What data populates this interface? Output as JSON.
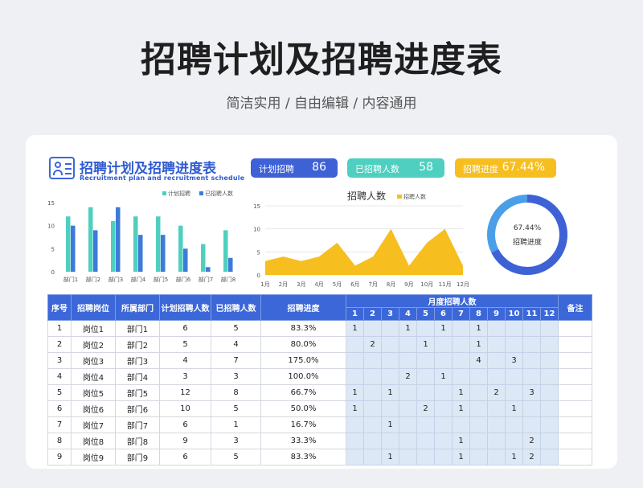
{
  "page": {
    "title": "招聘计划及招聘进度表",
    "subtitle": "简洁实用 / 自由编辑 / 内容通用"
  },
  "card": {
    "title": "招聘计划及招聘进度表",
    "title_en": "Recruitment plan and recruitment schedule",
    "kpis": [
      {
        "label": "计划招聘",
        "value": "86",
        "color": "#3e62d6"
      },
      {
        "label": "已招聘人数",
        "value": "58",
        "color": "#4fcfbf"
      },
      {
        "label": "招聘进度",
        "value": "67.44%",
        "color": "#f6be1f"
      }
    ]
  },
  "chart_data": [
    {
      "type": "bar",
      "categories": [
        "部门1",
        "部门2",
        "部门3",
        "部门4",
        "部门5",
        "部门6",
        "部门7",
        "部门8"
      ],
      "series": [
        {
          "name": "计划招聘",
          "values": [
            12,
            14,
            11,
            12,
            12,
            10,
            6,
            9
          ],
          "color": "#4fcfbf"
        },
        {
          "name": "已招聘人数",
          "values": [
            10,
            9,
            14,
            8,
            8,
            5,
            1,
            3
          ],
          "color": "#3e7ad8"
        }
      ],
      "ylim": [
        0,
        15
      ],
      "yticks": [
        "15",
        "10",
        "5",
        "0"
      ],
      "legend": "top-right"
    },
    {
      "type": "area",
      "title": "招聘人数",
      "categories": [
        "1月",
        "2月",
        "3月",
        "4月",
        "5月",
        "6月",
        "7月",
        "8月",
        "9月",
        "10月",
        "11月",
        "12月"
      ],
      "series": [
        {
          "name": "招聘人数",
          "values": [
            3,
            4,
            3,
            4,
            7,
            2,
            4,
            10,
            2,
            7,
            10,
            2
          ],
          "color": "#f6be1f"
        }
      ],
      "ylim": [
        0,
        15
      ],
      "yticks": [
        "15",
        "10",
        "5",
        "0"
      ],
      "grid": true,
      "legend": "top"
    },
    {
      "type": "pie",
      "title": "招聘进度",
      "value_label": "67.44%",
      "value": 67.44,
      "colors": {
        "done": "#3e62d6",
        "rest": "#4a9fe8"
      }
    }
  ],
  "table": {
    "headers": [
      "序号",
      "招聘岗位",
      "所属部门",
      "计划招聘人数",
      "已招聘人数",
      "招聘进度",
      "月度招聘人数",
      "备注"
    ],
    "months": [
      "1",
      "2",
      "3",
      "4",
      "5",
      "6",
      "7",
      "8",
      "9",
      "10",
      "11",
      "12"
    ],
    "rows": [
      {
        "no": "1",
        "post": "岗位1",
        "dept": "部门1",
        "plan": "6",
        "hired": "5",
        "progress": "83.3%",
        "m": [
          "1",
          "",
          "",
          "1",
          "",
          "1",
          "",
          "1",
          "",
          "",
          "",
          ""
        ]
      },
      {
        "no": "2",
        "post": "岗位2",
        "dept": "部门2",
        "plan": "5",
        "hired": "4",
        "progress": "80.0%",
        "m": [
          "",
          "2",
          "",
          "",
          "1",
          "",
          "",
          "1",
          "",
          "",
          "",
          ""
        ]
      },
      {
        "no": "3",
        "post": "岗位3",
        "dept": "部门3",
        "plan": "4",
        "hired": "7",
        "progress": "175.0%",
        "m": [
          "",
          "",
          "",
          "",
          "",
          "",
          "",
          "4",
          "",
          "3",
          "",
          ""
        ]
      },
      {
        "no": "4",
        "post": "岗位4",
        "dept": "部门4",
        "plan": "3",
        "hired": "3",
        "progress": "100.0%",
        "m": [
          "",
          "",
          "",
          "2",
          "",
          "1",
          "",
          "",
          "",
          "",
          "",
          ""
        ]
      },
      {
        "no": "5",
        "post": "岗位5",
        "dept": "部门5",
        "plan": "12",
        "hired": "8",
        "progress": "66.7%",
        "m": [
          "1",
          "",
          "1",
          "",
          "",
          "",
          "1",
          "",
          "2",
          "",
          "3",
          ""
        ]
      },
      {
        "no": "6",
        "post": "岗位6",
        "dept": "部门6",
        "plan": "10",
        "hired": "5",
        "progress": "50.0%",
        "m": [
          "1",
          "",
          "",
          "",
          "2",
          "",
          "1",
          "",
          "",
          "1",
          "",
          ""
        ]
      },
      {
        "no": "7",
        "post": "岗位7",
        "dept": "部门7",
        "plan": "6",
        "hired": "1",
        "progress": "16.7%",
        "m": [
          "",
          "",
          "1",
          "",
          "",
          "",
          "",
          "",
          "",
          "",
          "",
          ""
        ]
      },
      {
        "no": "8",
        "post": "岗位8",
        "dept": "部门8",
        "plan": "9",
        "hired": "3",
        "progress": "33.3%",
        "m": [
          "",
          "",
          "",
          "",
          "",
          "",
          "1",
          "",
          "",
          "",
          "2",
          ""
        ]
      },
      {
        "no": "9",
        "post": "岗位9",
        "dept": "部门9",
        "plan": "6",
        "hired": "5",
        "progress": "83.3%",
        "m": [
          "",
          "",
          "1",
          "",
          "",
          "",
          "1",
          "",
          "",
          "1",
          "2",
          ""
        ]
      }
    ]
  }
}
